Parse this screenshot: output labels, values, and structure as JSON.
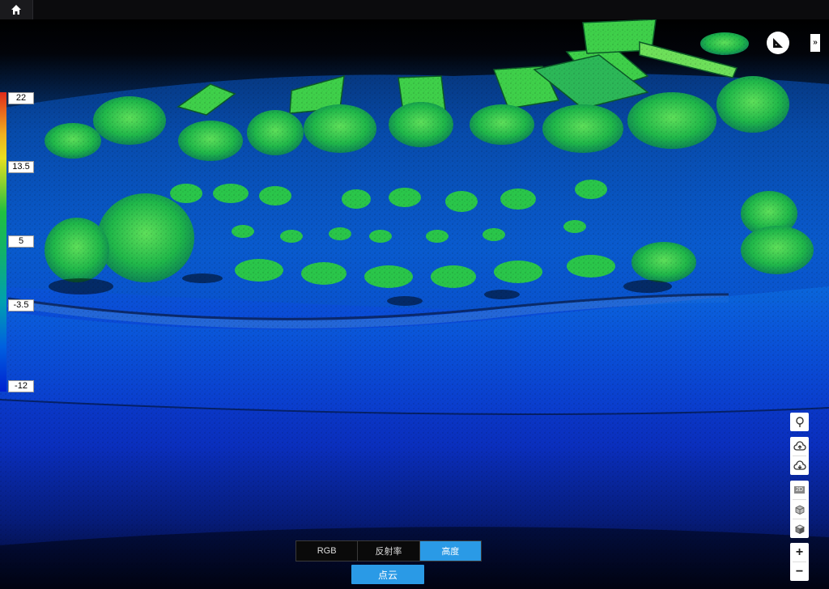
{
  "legend": {
    "labels": [
      "22",
      "13.5",
      "5",
      "-3.5",
      "-12"
    ]
  },
  "modes": {
    "items": [
      "RGB",
      "反射率",
      "高度"
    ],
    "active": 2
  },
  "pointcloud_button": "点云",
  "controls": {
    "expand_label": "»",
    "zoom_in": "+",
    "zoom_out": "−",
    "twod_label": "2D"
  },
  "icons": [
    "home-icon",
    "measure-icon",
    "tree-icon",
    "cloud-upload-icon",
    "cloud-download-icon",
    "cube-icon",
    "cube-shaded-icon"
  ],
  "colors": {
    "accent": "#2a9ae6",
    "legend_top": "#e02a1a",
    "legend_bottom": "#0020d0"
  }
}
